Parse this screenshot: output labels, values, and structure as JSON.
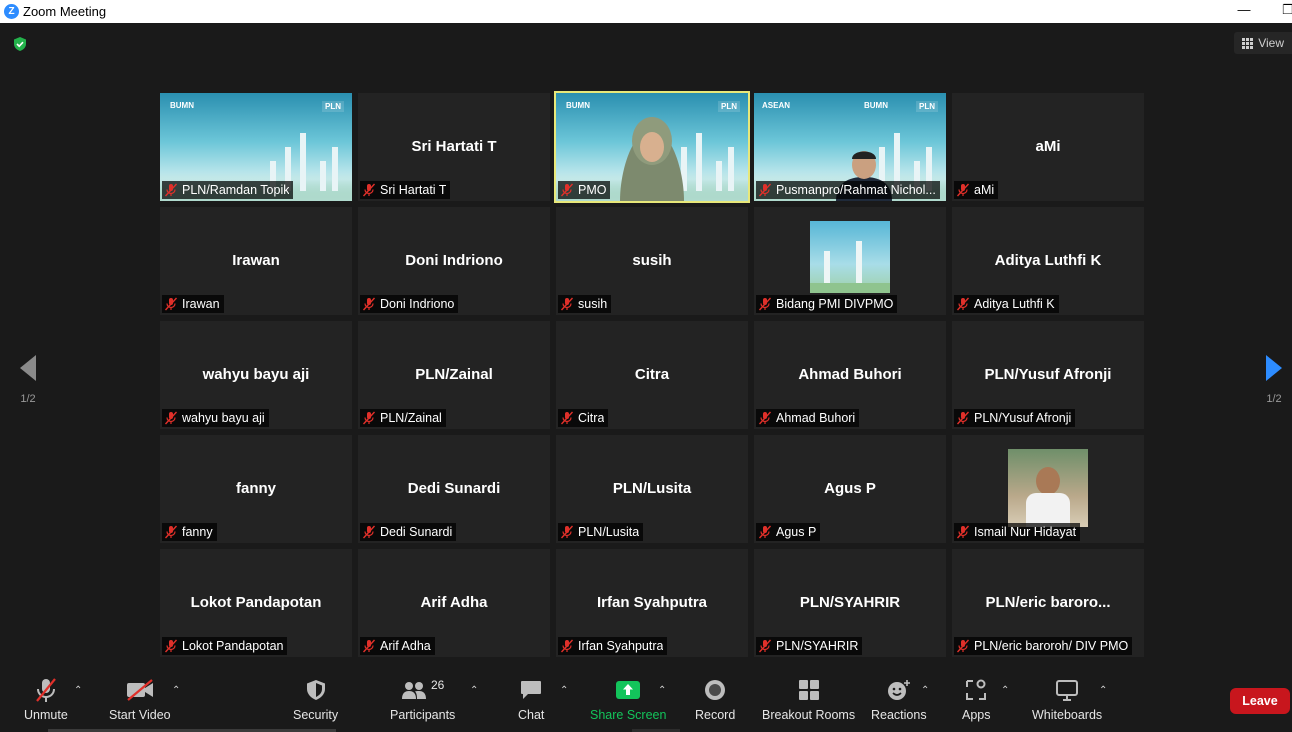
{
  "window": {
    "title": "Zoom Meeting",
    "app_icon": "Z"
  },
  "header": {
    "view_label": "View"
  },
  "pager": {
    "left_page": "1/2",
    "right_page": "1/2"
  },
  "tiles": [
    {
      "display": "",
      "label": "PLN/Ramdan Topik"
    },
    {
      "display": "Sri Hartati T",
      "label": "Sri Hartati T"
    },
    {
      "display": "",
      "label": "PMO"
    },
    {
      "display": "",
      "label": "Pusmanpro/Rahmat Nichol..."
    },
    {
      "display": "aMi",
      "label": "aMi"
    },
    {
      "display": "Irawan",
      "label": "Irawan"
    },
    {
      "display": "Doni Indriono",
      "label": "Doni Indriono"
    },
    {
      "display": "susih",
      "label": "susih"
    },
    {
      "display": "",
      "label": "Bidang PMI DIVPMO"
    },
    {
      "display": "Aditya Luthfi K",
      "label": "Aditya Luthfi K"
    },
    {
      "display": "wahyu bayu aji",
      "label": "wahyu bayu aji"
    },
    {
      "display": "PLN/Zainal",
      "label": "PLN/Zainal"
    },
    {
      "display": "Citra",
      "label": "Citra"
    },
    {
      "display": "Ahmad Buhori",
      "label": "Ahmad Buhori"
    },
    {
      "display": "PLN/Yusuf Afronji",
      "label": "PLN/Yusuf Afronji"
    },
    {
      "display": "fanny",
      "label": "fanny"
    },
    {
      "display": "Dedi Sunardi",
      "label": "Dedi Sunardi"
    },
    {
      "display": "PLN/Lusita",
      "label": "PLN/Lusita"
    },
    {
      "display": "Agus P",
      "label": "Agus P"
    },
    {
      "display": "",
      "label": "Ismail Nur Hidayat"
    },
    {
      "display": "Lokot Pandapotan",
      "label": "Lokot Pandapotan"
    },
    {
      "display": "Arif Adha",
      "label": "Arif Adha"
    },
    {
      "display": "Irfan Syahputra",
      "label": "Irfan Syahputra"
    },
    {
      "display": "PLN/SYAHRIR",
      "label": "PLN/SYAHRIR"
    },
    {
      "display": "PLN/eric  baroro...",
      "label": "PLN/eric baroroh/ DIV PMO"
    }
  ],
  "video_bg": {
    "bumn": "BUMN",
    "pln": "PLN",
    "asean": "ASEAN"
  },
  "toolbar": {
    "unmute": "Unmute",
    "start_video": "Start Video",
    "security": "Security",
    "participants": "Participants",
    "participants_count": "26",
    "chat": "Chat",
    "share_screen": "Share Screen",
    "record": "Record",
    "breakout_rooms": "Breakout Rooms",
    "reactions": "Reactions",
    "apps": "Apps",
    "whiteboards": "Whiteboards",
    "leave": "Leave"
  },
  "colors": {
    "share_green": "#13c45b",
    "leave_red": "#c8161d",
    "active_speaker": "#e8e87a",
    "nav_blue": "#2d8cff"
  }
}
